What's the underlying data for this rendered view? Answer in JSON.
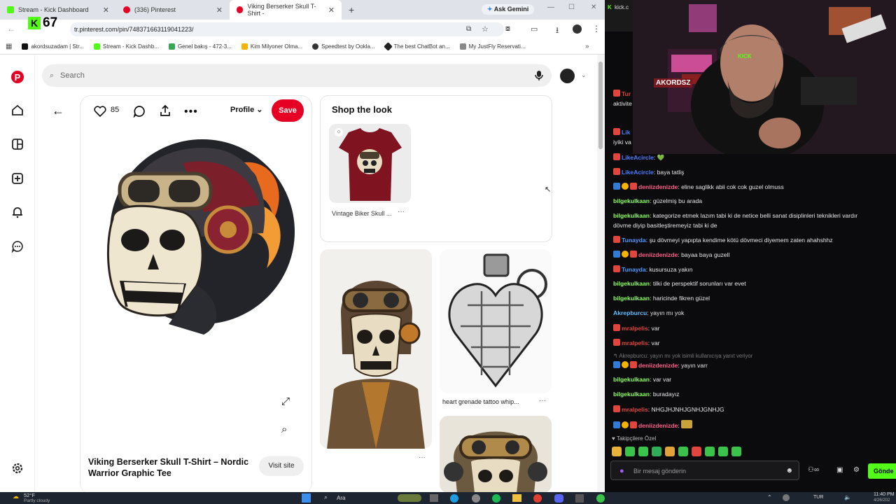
{
  "browser": {
    "tabs": [
      {
        "label": "Stream - Kick Dashboard",
        "color": "#53fc18"
      },
      {
        "label": "(336) Pinterest",
        "color": "#e60023"
      },
      {
        "label": "Viking Berserker Skull T-Shirt -",
        "color": "#e60023"
      }
    ],
    "gemini_label": "Ask Gemini",
    "url": "tr.pinterest.com/pin/748371663119041223/",
    "kick_badge": "67",
    "bookmarks": [
      {
        "label": "akordsuzadam | Str...",
        "color": "#111"
      },
      {
        "label": "Stream - Kick Dashb...",
        "color": "#53fc18"
      },
      {
        "label": "Genel bakış - 472-3...",
        "color": "#34a853"
      },
      {
        "label": "Kim Milyoner Olma...",
        "color": "#f4b400"
      },
      {
        "label": "Speedtest by Ookla...",
        "color": "#333"
      },
      {
        "label": "The best ChatBot an...",
        "color": "#222"
      },
      {
        "label": "My JustFly Reservati...",
        "color": "#888"
      }
    ]
  },
  "pinterest": {
    "search_placeholder": "Search",
    "like_count": "85",
    "profile_label": "Profile",
    "save_label": "Save",
    "pin_title": "Viking Berserker Skull T-Shirt – Nordic Warrior Graphic Tee",
    "visit_label": "Visit site",
    "shop_title": "Shop the look",
    "shop_item_label": "Vintage Biker Skull ...",
    "related_caption": "heart grenade tattoo whip...",
    "accent": "#e60023"
  },
  "chat": {
    "messages": [
      {
        "user": "Tur",
        "text": "",
        "color": "#e0463e"
      },
      {
        "user": "",
        "text": "aktivite",
        "color": "#e8e8e8"
      },
      {
        "user": "Lik",
        "text": "",
        "color": "#4d7cff"
      },
      {
        "user": "",
        "text": "iyiki va",
        "color": "#e8e8e8"
      },
      {
        "user": "LikeAcircle",
        "text": ": 💚",
        "color": "#4d7cff"
      },
      {
        "user": "LikeAcircle",
        "text": ": baya tatliş",
        "color": "#4d7cff"
      },
      {
        "user": "deniizdenizde",
        "text": ": eline saglikk abii cok cok guzel olmuss",
        "color": "#ff5e8a"
      },
      {
        "user": "bilgekulkaan",
        "text": ": güzelmiş bu arada",
        "color": "#8bff5e"
      },
      {
        "user": "bilgekulkaan",
        "text": ": kategorize etmek lazım tabi ki de netice belli sanat disiplinleri teknikleri vardır",
        "color": "#8bff5e"
      },
      {
        "user": "",
        "text": "dövme diyip basitleştiremeyiz tabi ki de",
        "color": "#e8e8e8"
      },
      {
        "user": "Tunayda",
        "text": ": şu dövmeyi yapıpta kendime kötü dövmeci diyemem zaten ahahshhz",
        "color": "#4d9cff"
      },
      {
        "user": "deniizdenizde",
        "text": ": bayaa baya guzell",
        "color": "#ff5e8a"
      },
      {
        "user": "Tunayda",
        "text": ": kusursuza yakın",
        "color": "#4d9cff"
      },
      {
        "user": "bilgekulkaan",
        "text": ": tilki de perspektif sorunları var evet",
        "color": "#8bff5e"
      },
      {
        "user": "bilgekulkaan",
        "text": ": haricinde fikren güzel",
        "color": "#8bff5e"
      },
      {
        "user": "Akrepburcu",
        "text": ": yayın mı yok",
        "color": "#5ec0ff"
      },
      {
        "user": "mralpelis",
        "text": ": var",
        "color": "#e0463e"
      },
      {
        "user": "mralpelis",
        "text": ": var",
        "color": "#e0463e"
      },
      {
        "user": "",
        "text": "↰ Akrepburcu: yayın mı yok isimli kullanıcıya yanıt veriyor",
        "color": "#777"
      },
      {
        "user": "deniizdenizde",
        "text": ": yayın varr",
        "color": "#ff5e8a"
      },
      {
        "user": "bilgekulkaan",
        "text": ": var var",
        "color": "#8bff5e"
      },
      {
        "user": "bilgekulkaan",
        "text": ": buradayız",
        "color": "#8bff5e"
      },
      {
        "user": "mralpelis",
        "text": ": NHGJHJNHJGNHJGNHJG",
        "color": "#e0463e"
      },
      {
        "user": "deniizdenizde",
        "text": ": ",
        "color": "#ff5e8a"
      }
    ],
    "followers_label": "♥ Takipçilere Özel",
    "input_placeholder": "Bir mesaj gönderin",
    "send_label": "Gönde",
    "cam_banner": "AKORDSZ",
    "cam_brand": "KICK"
  },
  "taskbar": {
    "weather_temp": "52°F",
    "weather_text": "Partly cloudy",
    "search_label": "Ara",
    "lang": "TUR",
    "time": "11:40 PM",
    "date": "4/26/202"
  }
}
